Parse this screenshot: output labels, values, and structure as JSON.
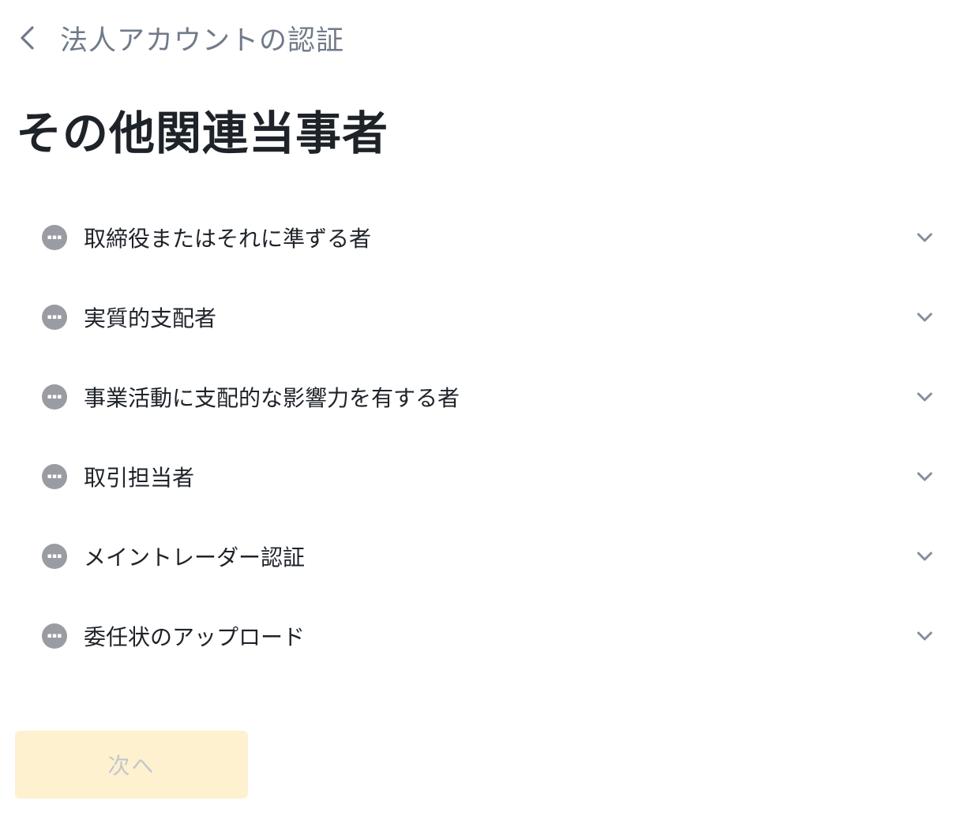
{
  "header": {
    "back_icon": "chevron-left-icon",
    "title": "法人アカウントの認証"
  },
  "page": {
    "title": "その他関連当事者"
  },
  "sections": [
    {
      "label": "取締役またはそれに準ずる者",
      "status_icon": "more-dots-icon",
      "expand_icon": "chevron-down-icon"
    },
    {
      "label": "実質的支配者",
      "status_icon": "more-dots-icon",
      "expand_icon": "chevron-down-icon"
    },
    {
      "label": "事業活動に支配的な影響力を有する者",
      "status_icon": "more-dots-icon",
      "expand_icon": "chevron-down-icon"
    },
    {
      "label": "取引担当者",
      "status_icon": "more-dots-icon",
      "expand_icon": "chevron-down-icon"
    },
    {
      "label": "メイントレーダー認証",
      "status_icon": "more-dots-icon",
      "expand_icon": "chevron-down-icon"
    },
    {
      "label": "委任状のアップロード",
      "status_icon": "more-dots-icon",
      "expand_icon": "chevron-down-icon"
    }
  ],
  "footer": {
    "next_label": "次へ",
    "next_enabled": false
  },
  "colors": {
    "text_primary": "#1e2329",
    "text_secondary": "#707a8a",
    "status_icon": "#9a9ca3",
    "chevron": "#848e9c",
    "button_disabled_bg": "#fef1cf",
    "button_disabled_text": "#c3c6cb"
  }
}
